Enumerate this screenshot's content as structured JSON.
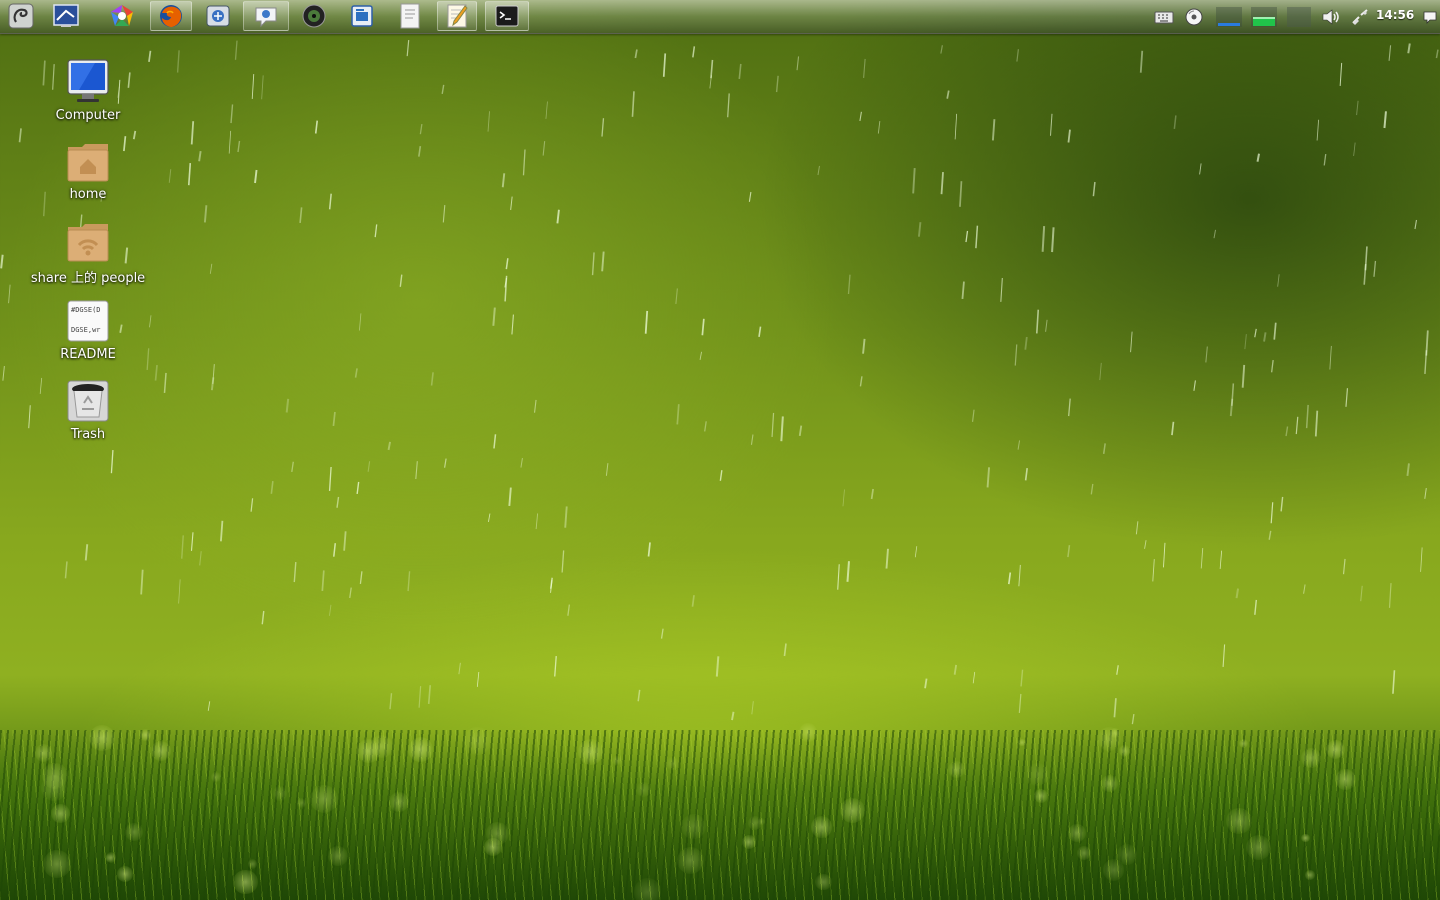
{
  "panel": {
    "launchers": [
      {
        "name": "app-menu-icon"
      },
      {
        "name": "desktop-manager-icon"
      },
      {
        "name": "web-browser-chrome-icon"
      },
      {
        "name": "firefox-icon"
      },
      {
        "name": "mail-client-icon"
      },
      {
        "name": "chat-client-icon"
      },
      {
        "name": "media-player-icon"
      },
      {
        "name": "document-viewer-icon"
      },
      {
        "name": "file-manager-icon"
      },
      {
        "name": "text-editor-icon"
      },
      {
        "name": "terminal-icon"
      }
    ],
    "tray": [
      {
        "name": "keyboard-icon"
      },
      {
        "name": "disc-icon"
      },
      {
        "name": "network-monitor-icon"
      },
      {
        "name": "cpu-monitor-icon"
      },
      {
        "name": "workspace-icon"
      },
      {
        "name": "volume-icon"
      },
      {
        "name": "network-icon"
      }
    ],
    "clock": "14:56",
    "notification_icon": "chat-bubble-icon"
  },
  "desktop": {
    "icons": [
      {
        "label": "Computer",
        "icon": "computer-icon"
      },
      {
        "label": "home",
        "icon": "home-folder-icon"
      },
      {
        "label": "share 上的 people",
        "icon": "network-share-folder-icon"
      },
      {
        "label": "README",
        "icon": "text-file-icon",
        "preview_lines": [
          "#DGSE(D",
          "DGSE,wr"
        ]
      },
      {
        "label": "Trash",
        "icon": "trash-icon"
      }
    ]
  },
  "colors": {
    "wallpaper_green": "#7a9a1a",
    "folder_tan": "#d9ab72",
    "label_text": "#ffffff"
  }
}
